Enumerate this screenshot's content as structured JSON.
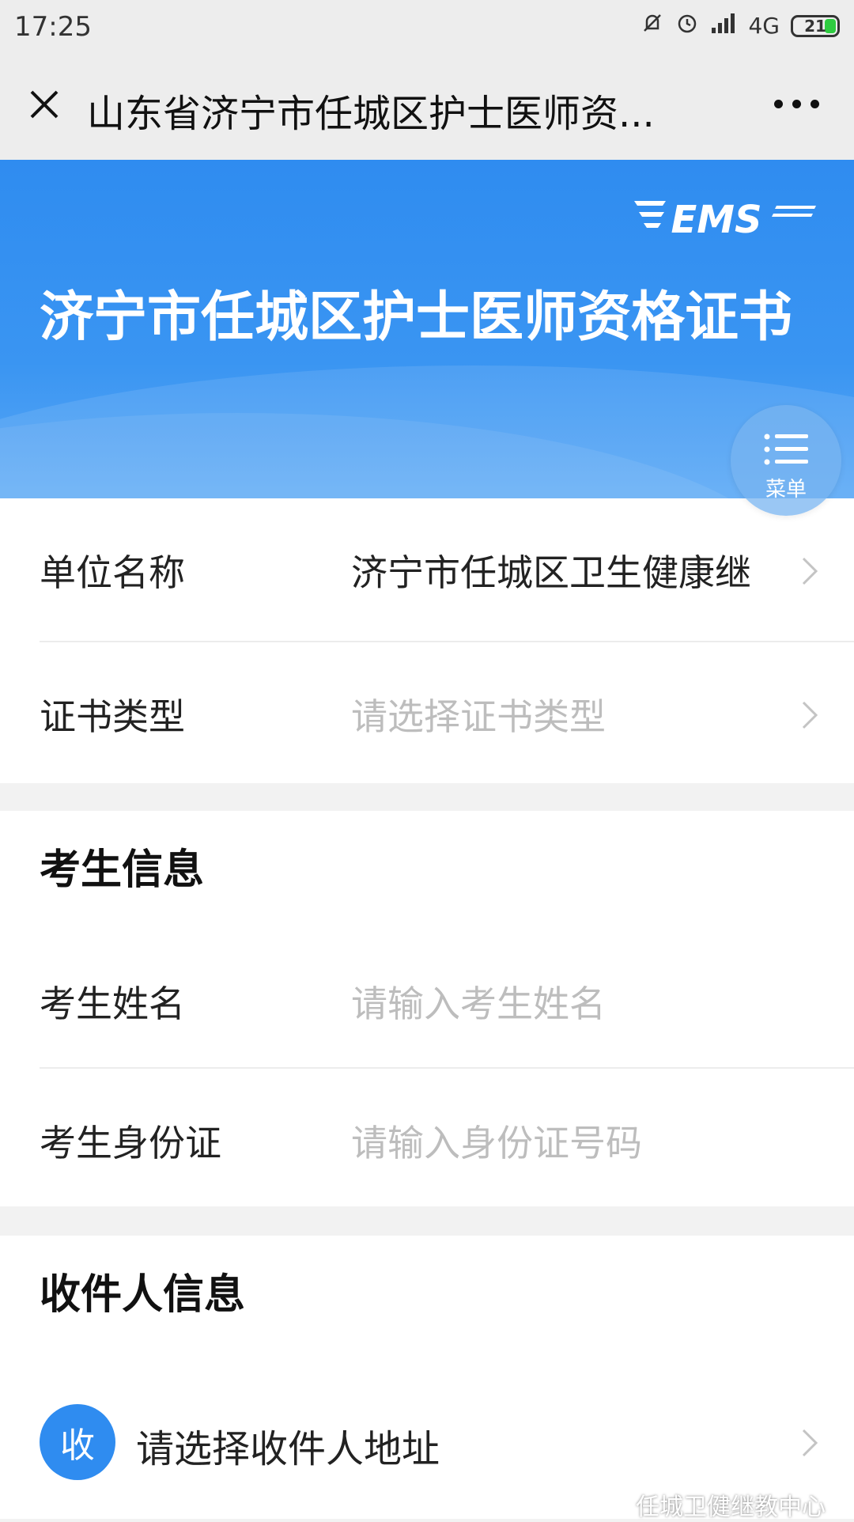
{
  "status_bar": {
    "time": "17:25",
    "network": "4G",
    "battery": "21"
  },
  "nav": {
    "title": "山东省济宁市任城区护士医师资..."
  },
  "banner": {
    "logo_text": "EMS",
    "headline": "济宁市任城区护士医师资格证书",
    "menu_label": "菜单"
  },
  "form": {
    "unit_label": "单位名称",
    "unit_value": "济宁市任城区卫生健康继",
    "cert_type_label": "证书类型",
    "cert_type_placeholder": "请选择证书类型"
  },
  "examinee": {
    "section_title": "考生信息",
    "name_label": "考生姓名",
    "name_placeholder": "请输入考生姓名",
    "id_label": "考生身份证",
    "id_placeholder": "请输入身份证号码"
  },
  "recipient": {
    "section_title": "收件人信息",
    "badge": "收",
    "address_placeholder": "请选择收件人地址"
  },
  "watermark": "任城卫健继教中心",
  "colors": {
    "accent": "#2f8cf0",
    "placeholder": "#bdbdbd"
  }
}
